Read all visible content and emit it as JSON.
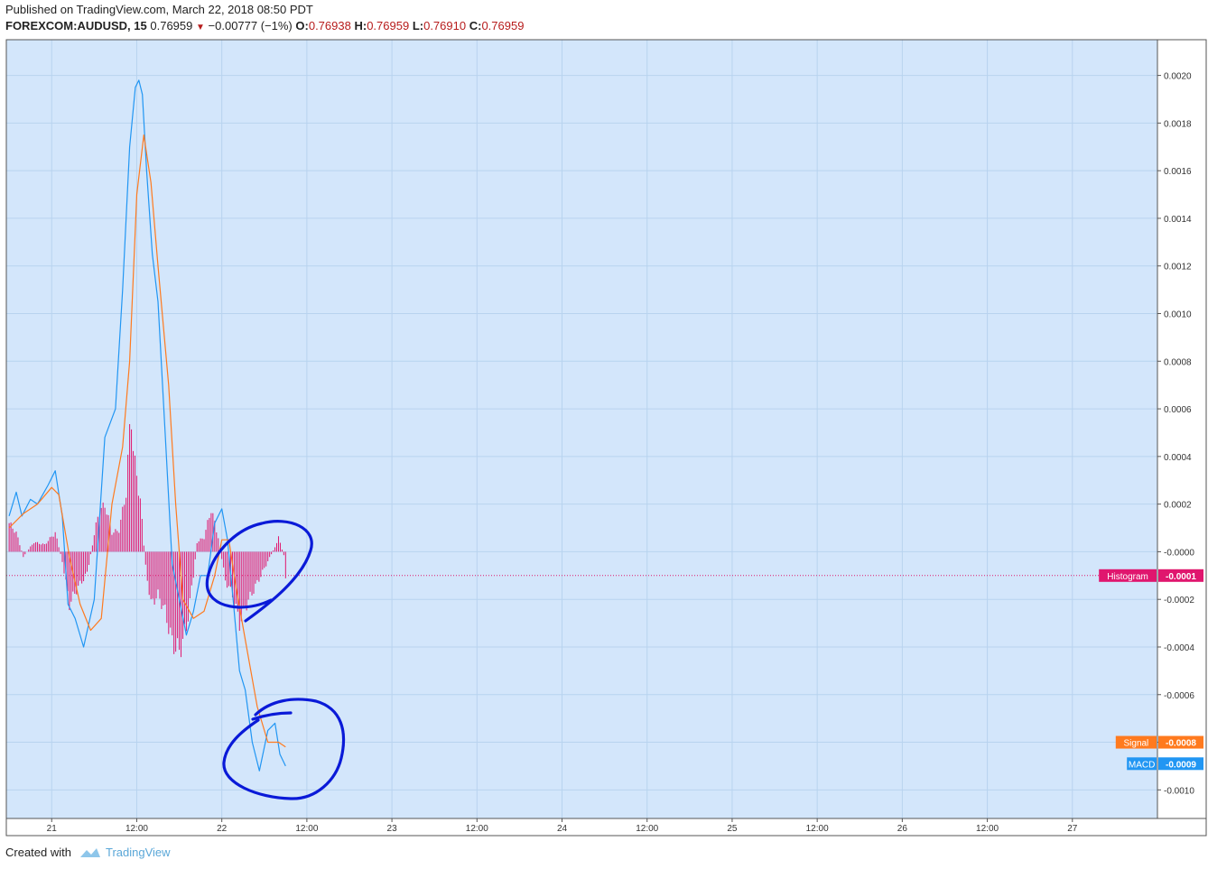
{
  "header": {
    "published": "Published on TradingView.com, March 22, 2018 08:50 PDT",
    "symbol": "FOREXCOM:AUDUSD, 15",
    "price": "0.76959",
    "change": "−0.00777 (−1%)",
    "open_label": "O:",
    "open": "0.76938",
    "high_label": "H:",
    "high": "0.76959",
    "low_label": "L:",
    "low": "0.76910",
    "close_label": "C:",
    "close": "0.76959"
  },
  "footer": {
    "created_with": "Created with",
    "brand": "TradingView"
  },
  "colors": {
    "background": "#d3e6fb",
    "grid": "#b8d3ef",
    "macd": "#2196f3",
    "signal": "#ff7a1e",
    "histogram": "#e0166e",
    "annotation": "#0a1ad8"
  },
  "chart_data": {
    "type": "line",
    "title": "",
    "y_ticks": [
      "0.0020",
      "0.0018",
      "0.0016",
      "0.0014",
      "0.0012",
      "0.0010",
      "0.0008",
      "0.0006",
      "0.0004",
      "0.0002",
      "-0.0000",
      "-0.0002",
      "-0.0004",
      "-0.0006",
      "-0.0008",
      "-0.0010"
    ],
    "y_tick_values": [
      0.002,
      0.0018,
      0.0016,
      0.0014,
      0.0012,
      0.001,
      0.0008,
      0.0006,
      0.0004,
      0.0002,
      0,
      -0.0002,
      -0.0004,
      -0.0006,
      -0.0008,
      -0.001
    ],
    "ylim": [
      -0.00112,
      0.00215
    ],
    "x_ticks": [
      "21",
      "12:00",
      "22",
      "12:00",
      "23",
      "12:00",
      "24",
      "12:00",
      "25",
      "12:00",
      "26",
      "12:00",
      "27"
    ],
    "x_tick_values": [
      0,
      12,
      24,
      36,
      48,
      60,
      72,
      84,
      96,
      108,
      120,
      132,
      144
    ],
    "xlim": [
      -6.4,
      156
    ],
    "x_unit": "hours from Mar 21 00:00",
    "series": [
      {
        "key": "macd",
        "x": [
          -6.0,
          -5.0,
          -4.2,
          -3.0,
          -2.0,
          -0.5,
          0.5,
          1.5,
          2.3,
          3.3,
          4.5,
          6.0,
          7.5,
          9.0,
          10.0,
          11.0,
          11.8,
          12.3,
          12.8,
          13.4,
          14.2,
          15.0,
          16.0,
          17.0,
          18.0,
          19.0,
          20.0,
          21.0,
          22.0,
          23.0,
          24.0,
          24.8,
          25.6,
          26.5,
          27.3,
          28.3,
          29.3,
          30.5,
          31.5,
          32.2,
          33.0
        ],
        "values": [
          0.00015,
          0.00025,
          0.00015,
          0.00022,
          0.0002,
          0.00028,
          0.00034,
          0.00015,
          -0.00022,
          -0.00028,
          -0.0004,
          -0.0002,
          0.00048,
          0.0006,
          0.0011,
          0.0017,
          0.00195,
          0.00198,
          0.00192,
          0.0016,
          0.00125,
          0.00105,
          0.0005,
          -5e-05,
          -0.0002,
          -0.00035,
          -0.00025,
          -0.0001,
          -0.0001,
          0.00012,
          0.00018,
          5e-05,
          -0.0002,
          -0.0005,
          -0.00058,
          -0.0008,
          -0.00092,
          -0.00075,
          -0.00072,
          -0.00085,
          -0.0009
        ]
      },
      {
        "key": "signal",
        "x": [
          -6.0,
          -4.0,
          -2.0,
          0.0,
          1.0,
          2.5,
          4.0,
          5.5,
          7.0,
          8.5,
          10.0,
          11.0,
          12.0,
          13.0,
          14.0,
          15.0,
          16.5,
          17.5,
          18.5,
          20.0,
          21.5,
          23.0,
          24.0,
          25.0,
          26.0,
          27.5,
          29.0,
          30.5,
          32.0,
          33.0
        ],
        "values": [
          0.0001,
          0.00016,
          0.0002,
          0.00027,
          0.00024,
          -2e-05,
          -0.00022,
          -0.00033,
          -0.00028,
          0.0002,
          0.00044,
          0.0008,
          0.0015,
          0.00175,
          0.00155,
          0.0012,
          0.0007,
          0.0002,
          -0.0002,
          -0.00028,
          -0.00025,
          -0.0001,
          5e-05,
          5e-05,
          -0.00015,
          -0.0004,
          -0.00065,
          -0.0008,
          -0.0008,
          -0.00082
        ]
      }
    ],
    "histogram": {
      "key": "histogram",
      "x_start": -6.0,
      "x_step": 0.25,
      "count": 157,
      "anchors_x": [
        -6.0,
        -5.0,
        -4.0,
        -2.5,
        -1.0,
        0.5,
        1.5,
        2.5,
        3.5,
        5.0,
        6.5,
        7.5,
        8.5,
        9.5,
        10.5,
        11.2,
        11.6,
        12.5,
        13.2,
        14.0,
        15.0,
        16.0,
        17.0,
        18.0,
        19.0,
        20.0,
        20.5,
        21.5,
        22.5,
        23.5,
        24.5,
        25.5,
        26.5,
        27.5,
        28.5,
        29.5,
        30.5,
        31.5,
        32.0,
        32.8,
        33.0
      ],
      "anchors_v": [
        0.00012,
        8e-05,
        -2e-05,
        4e-05,
        3e-05,
        8e-05,
        -4e-05,
        -0.00022,
        -0.00016,
        -9e-05,
        0.00015,
        0.0002,
        8e-05,
        9e-05,
        0.00025,
        0.0006,
        0.00039,
        0.00022,
        -5e-05,
        -0.00022,
        -0.00018,
        -0.00025,
        -0.00038,
        -0.00042,
        -0.00032,
        -0.0001,
        4e-05,
        6e-05,
        0.00018,
        6e-05,
        -0.00012,
        -0.00018,
        -0.0003,
        -0.00022,
        -0.00016,
        -0.0001,
        -4e-05,
        2e-05,
        6e-05,
        -2e-05,
        -0.0001
      ]
    },
    "last_values": [
      {
        "label": "Histogram",
        "value": "-0.0001",
        "v": -0.0001,
        "color": "#e0166e"
      },
      {
        "label": "Signal",
        "value": "-0.0008",
        "v": -0.0008,
        "color": "#ff7a1e"
      },
      {
        "label": "MACD",
        "value": "-0.0009",
        "v": -0.00089,
        "color": "#2196f3"
      }
    ]
  }
}
